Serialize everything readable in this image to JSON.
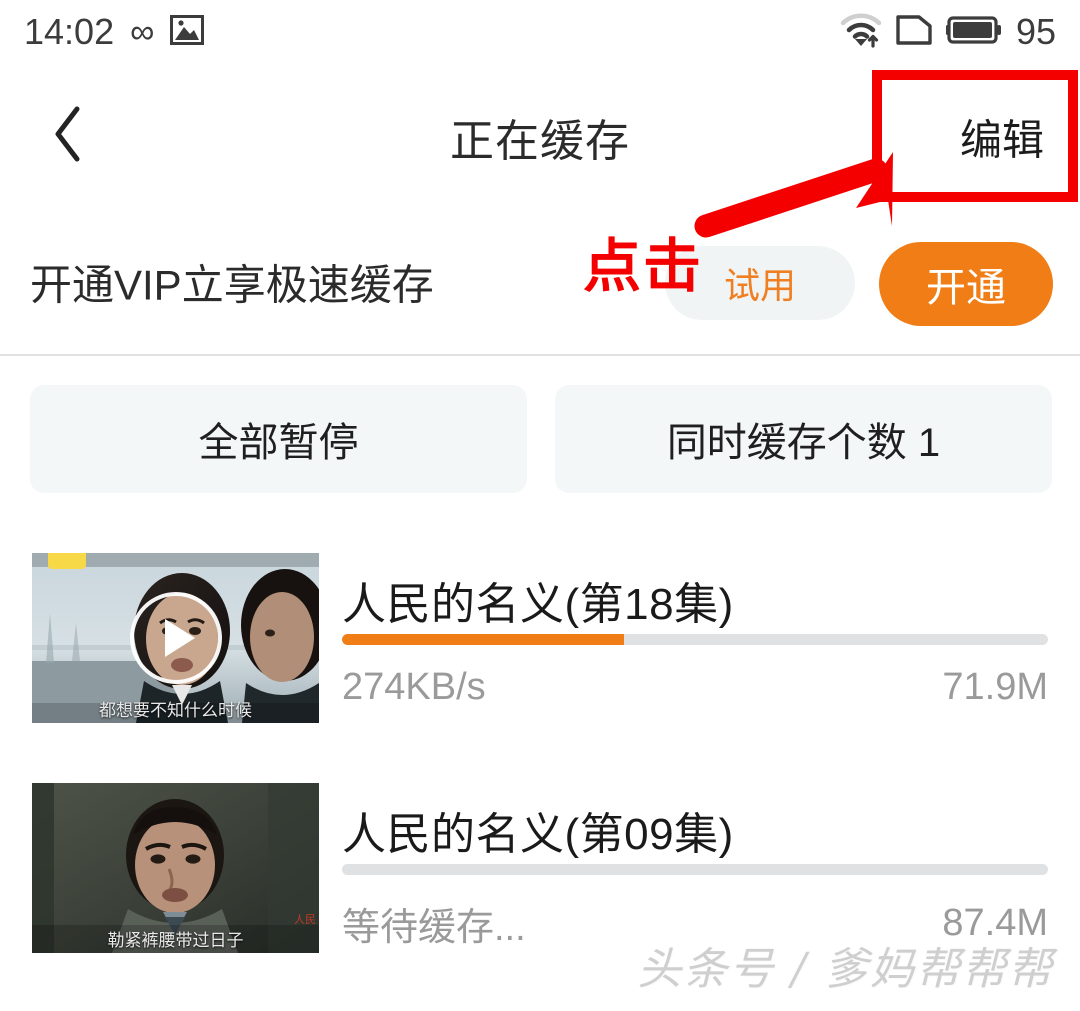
{
  "status_bar": {
    "time": "14:02",
    "infinity_glyph": "∞",
    "icons": [
      "infinity-icon",
      "screenshot-icon",
      "wifi-icon",
      "sim-card-icon",
      "battery-icon"
    ],
    "battery_percent": "95"
  },
  "nav": {
    "back_icon": "chevron-left-icon",
    "title": "正在缓存",
    "edit_label": "编辑"
  },
  "vip": {
    "text": "开通VIP立享极速缓存",
    "trial_label": "试用",
    "open_label": "开通",
    "accent_color": "#f07d16",
    "trial_bg": "#f1f4f5"
  },
  "actions": {
    "pause_all": "全部暂停",
    "concurrent_count": "同时缓存个数 1"
  },
  "downloads": [
    {
      "title": "人民的名义(第18集)",
      "speed": "274KB/s",
      "size": "71.9M",
      "progress": 40,
      "thumb_subtitle": "都想要不知什么时候",
      "badge": "yellow-badge",
      "play_icon": "play-icon"
    },
    {
      "title": "人民的名义(第09集)",
      "speed": "等待缓存...",
      "size": "87.4M",
      "progress": 0,
      "thumb_subtitle": "勒紧裤腰带过日子",
      "badge": null,
      "play_icon": null
    }
  ],
  "annotations": {
    "click_label": "点击",
    "highlight_color": "#f40000",
    "arrow_icon": "arrow-up-right-icon",
    "highlight_target": "编辑"
  },
  "watermark": "头条号 / 爹妈帮帮帮"
}
